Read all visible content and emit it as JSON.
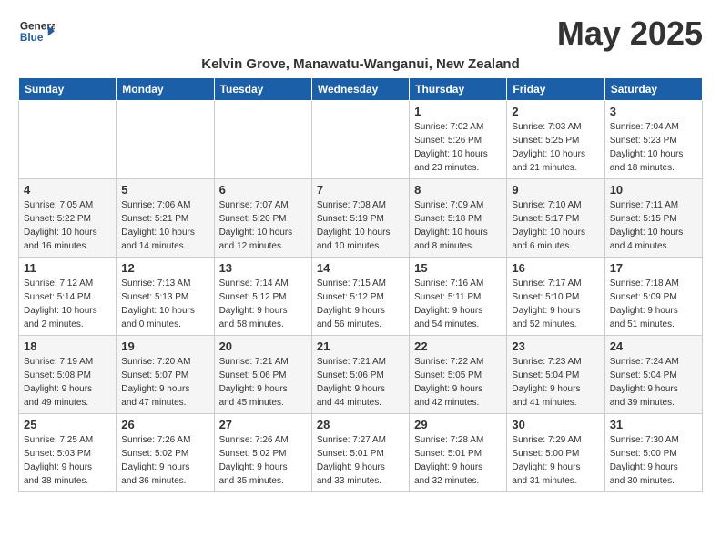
{
  "header": {
    "logo_general": "General",
    "logo_blue": "Blue",
    "month_title": "May 2025",
    "location": "Kelvin Grove, Manawatu-Wanganui, New Zealand"
  },
  "weekdays": [
    "Sunday",
    "Monday",
    "Tuesday",
    "Wednesday",
    "Thursday",
    "Friday",
    "Saturday"
  ],
  "weeks": [
    [
      {
        "day": "",
        "info": ""
      },
      {
        "day": "",
        "info": ""
      },
      {
        "day": "",
        "info": ""
      },
      {
        "day": "",
        "info": ""
      },
      {
        "day": "1",
        "info": "Sunrise: 7:02 AM\nSunset: 5:26 PM\nDaylight: 10 hours\nand 23 minutes."
      },
      {
        "day": "2",
        "info": "Sunrise: 7:03 AM\nSunset: 5:25 PM\nDaylight: 10 hours\nand 21 minutes."
      },
      {
        "day": "3",
        "info": "Sunrise: 7:04 AM\nSunset: 5:23 PM\nDaylight: 10 hours\nand 18 minutes."
      }
    ],
    [
      {
        "day": "4",
        "info": "Sunrise: 7:05 AM\nSunset: 5:22 PM\nDaylight: 10 hours\nand 16 minutes."
      },
      {
        "day": "5",
        "info": "Sunrise: 7:06 AM\nSunset: 5:21 PM\nDaylight: 10 hours\nand 14 minutes."
      },
      {
        "day": "6",
        "info": "Sunrise: 7:07 AM\nSunset: 5:20 PM\nDaylight: 10 hours\nand 12 minutes."
      },
      {
        "day": "7",
        "info": "Sunrise: 7:08 AM\nSunset: 5:19 PM\nDaylight: 10 hours\nand 10 minutes."
      },
      {
        "day": "8",
        "info": "Sunrise: 7:09 AM\nSunset: 5:18 PM\nDaylight: 10 hours\nand 8 minutes."
      },
      {
        "day": "9",
        "info": "Sunrise: 7:10 AM\nSunset: 5:17 PM\nDaylight: 10 hours\nand 6 minutes."
      },
      {
        "day": "10",
        "info": "Sunrise: 7:11 AM\nSunset: 5:15 PM\nDaylight: 10 hours\nand 4 minutes."
      }
    ],
    [
      {
        "day": "11",
        "info": "Sunrise: 7:12 AM\nSunset: 5:14 PM\nDaylight: 10 hours\nand 2 minutes."
      },
      {
        "day": "12",
        "info": "Sunrise: 7:13 AM\nSunset: 5:13 PM\nDaylight: 10 hours\nand 0 minutes."
      },
      {
        "day": "13",
        "info": "Sunrise: 7:14 AM\nSunset: 5:12 PM\nDaylight: 9 hours\nand 58 minutes."
      },
      {
        "day": "14",
        "info": "Sunrise: 7:15 AM\nSunset: 5:12 PM\nDaylight: 9 hours\nand 56 minutes."
      },
      {
        "day": "15",
        "info": "Sunrise: 7:16 AM\nSunset: 5:11 PM\nDaylight: 9 hours\nand 54 minutes."
      },
      {
        "day": "16",
        "info": "Sunrise: 7:17 AM\nSunset: 5:10 PM\nDaylight: 9 hours\nand 52 minutes."
      },
      {
        "day": "17",
        "info": "Sunrise: 7:18 AM\nSunset: 5:09 PM\nDaylight: 9 hours\nand 51 minutes."
      }
    ],
    [
      {
        "day": "18",
        "info": "Sunrise: 7:19 AM\nSunset: 5:08 PM\nDaylight: 9 hours\nand 49 minutes."
      },
      {
        "day": "19",
        "info": "Sunrise: 7:20 AM\nSunset: 5:07 PM\nDaylight: 9 hours\nand 47 minutes."
      },
      {
        "day": "20",
        "info": "Sunrise: 7:21 AM\nSunset: 5:06 PM\nDaylight: 9 hours\nand 45 minutes."
      },
      {
        "day": "21",
        "info": "Sunrise: 7:21 AM\nSunset: 5:06 PM\nDaylight: 9 hours\nand 44 minutes."
      },
      {
        "day": "22",
        "info": "Sunrise: 7:22 AM\nSunset: 5:05 PM\nDaylight: 9 hours\nand 42 minutes."
      },
      {
        "day": "23",
        "info": "Sunrise: 7:23 AM\nSunset: 5:04 PM\nDaylight: 9 hours\nand 41 minutes."
      },
      {
        "day": "24",
        "info": "Sunrise: 7:24 AM\nSunset: 5:04 PM\nDaylight: 9 hours\nand 39 minutes."
      }
    ],
    [
      {
        "day": "25",
        "info": "Sunrise: 7:25 AM\nSunset: 5:03 PM\nDaylight: 9 hours\nand 38 minutes."
      },
      {
        "day": "26",
        "info": "Sunrise: 7:26 AM\nSunset: 5:02 PM\nDaylight: 9 hours\nand 36 minutes."
      },
      {
        "day": "27",
        "info": "Sunrise: 7:26 AM\nSunset: 5:02 PM\nDaylight: 9 hours\nand 35 minutes."
      },
      {
        "day": "28",
        "info": "Sunrise: 7:27 AM\nSunset: 5:01 PM\nDaylight: 9 hours\nand 33 minutes."
      },
      {
        "day": "29",
        "info": "Sunrise: 7:28 AM\nSunset: 5:01 PM\nDaylight: 9 hours\nand 32 minutes."
      },
      {
        "day": "30",
        "info": "Sunrise: 7:29 AM\nSunset: 5:00 PM\nDaylight: 9 hours\nand 31 minutes."
      },
      {
        "day": "31",
        "info": "Sunrise: 7:30 AM\nSunset: 5:00 PM\nDaylight: 9 hours\nand 30 minutes."
      }
    ]
  ]
}
